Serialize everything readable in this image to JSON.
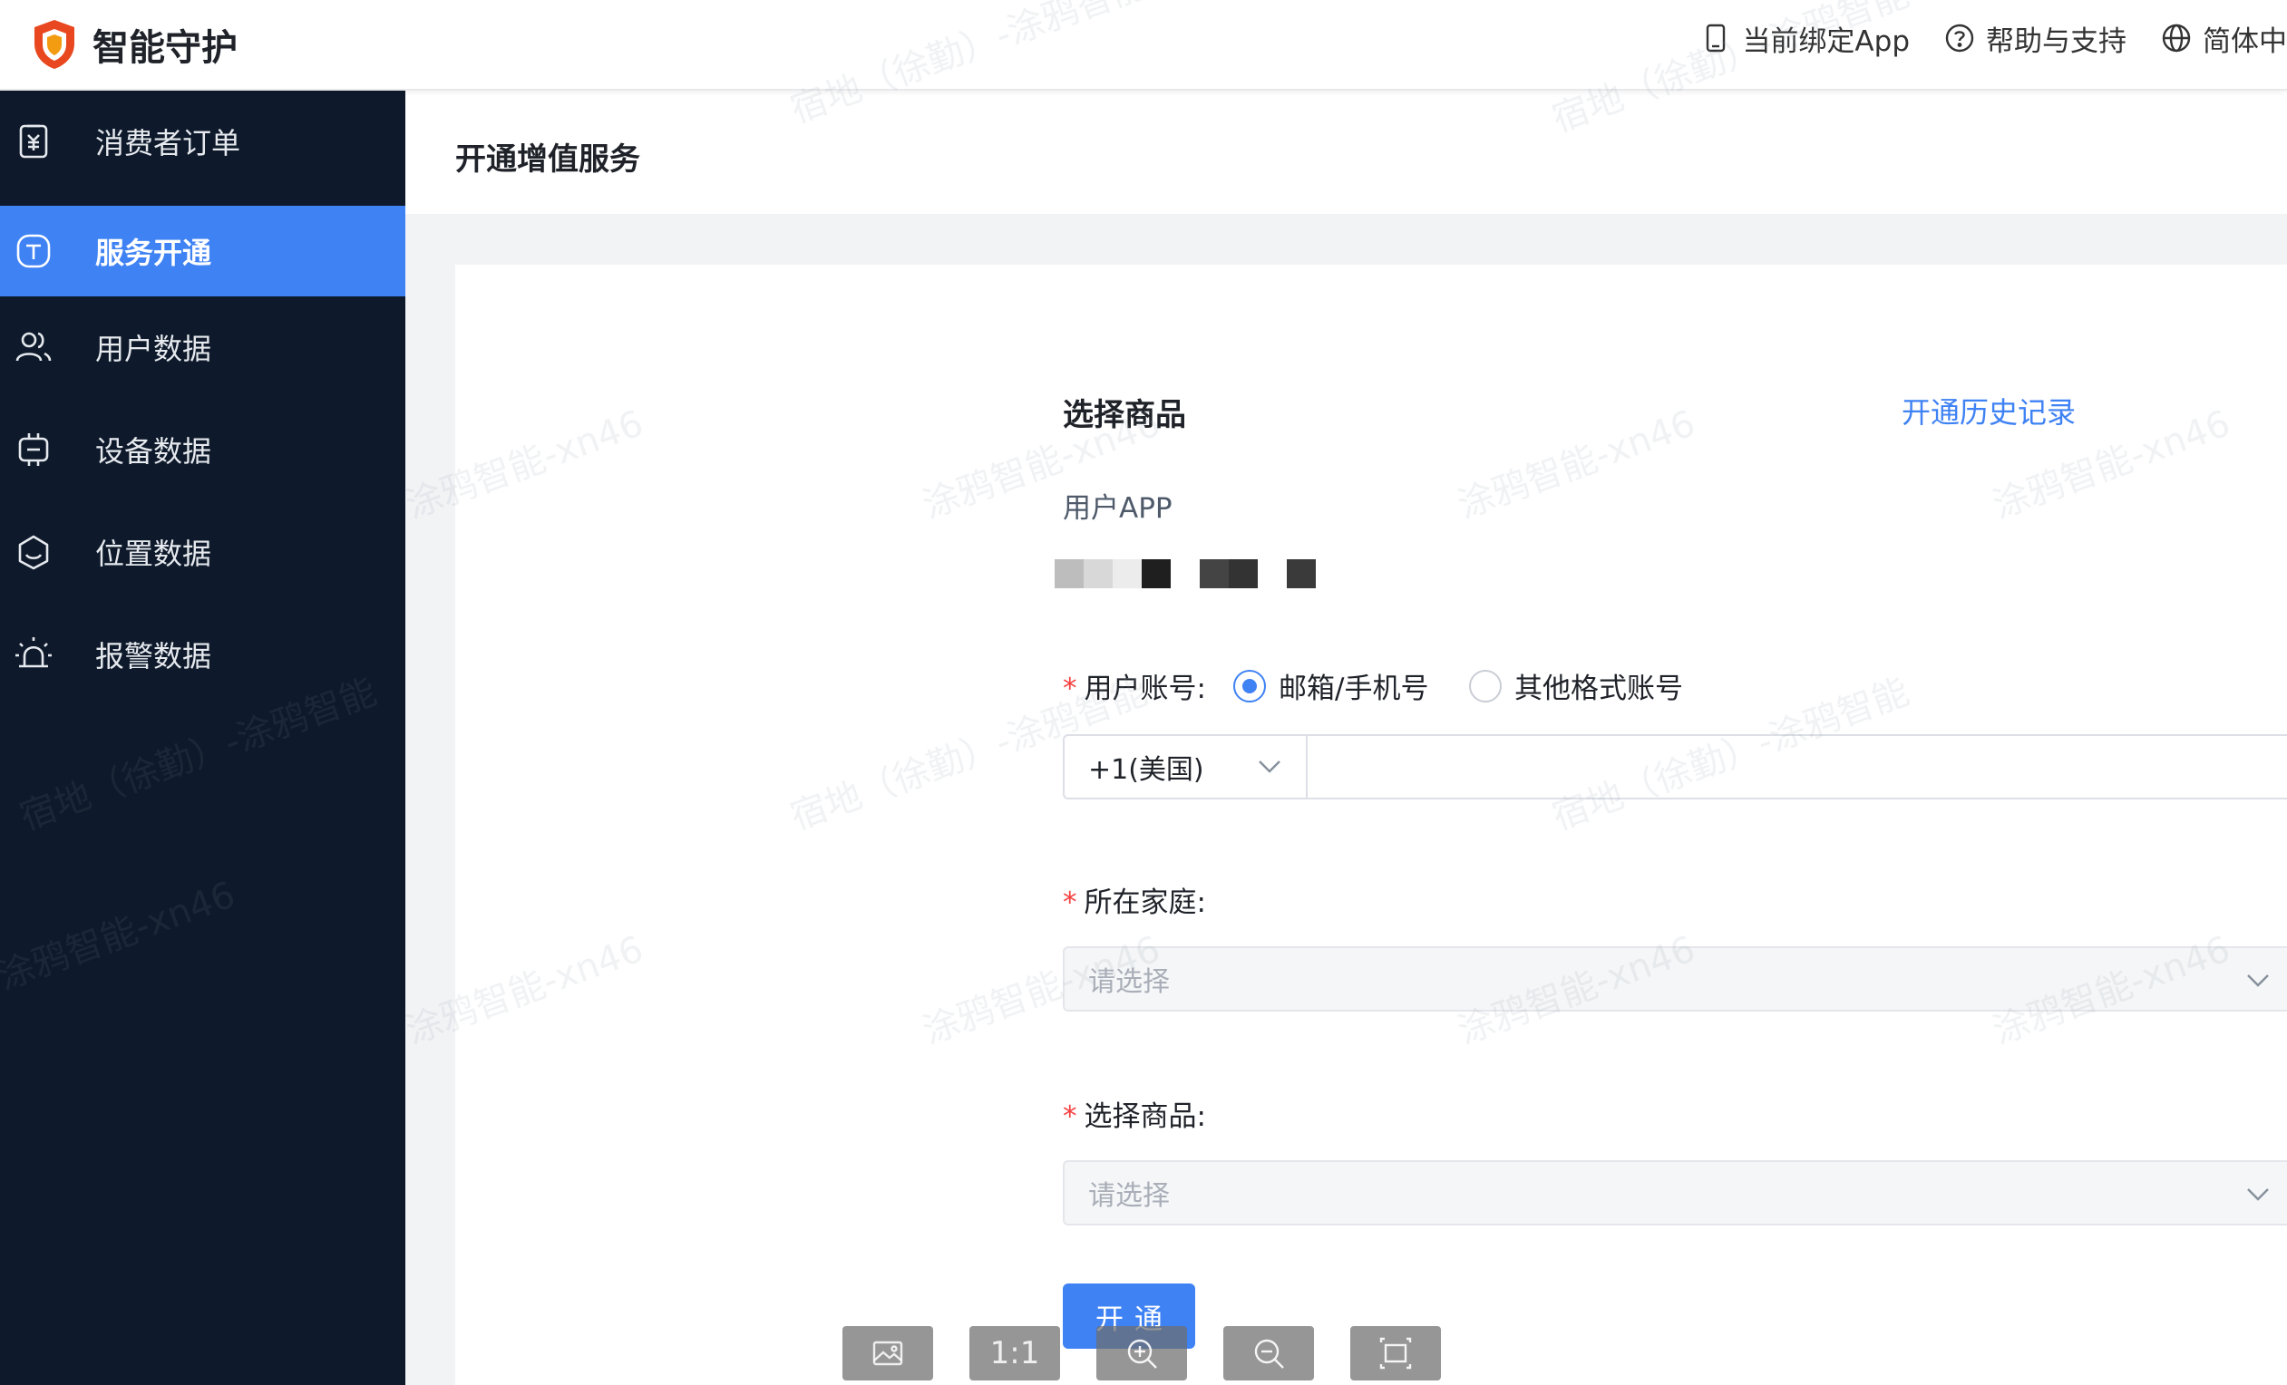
{
  "header": {
    "brand_title": "智能守护",
    "actions": [
      {
        "label": "当前绑定App",
        "icon": "tablet-icon"
      },
      {
        "label": "帮助与支持",
        "icon": "help-circle-icon"
      },
      {
        "label": "简体中",
        "icon": "globe-icon"
      }
    ]
  },
  "sidebar": {
    "items": [
      {
        "label": "消费者订单",
        "icon": "order-icon",
        "active": false
      },
      {
        "label": "服务开通",
        "icon": "service-box-icon",
        "active": true
      },
      {
        "label": "用户数据",
        "icon": "users-icon",
        "active": false
      },
      {
        "label": "设备数据",
        "icon": "device-icon",
        "active": false
      },
      {
        "label": "位置数据",
        "icon": "location-icon",
        "active": false
      },
      {
        "label": "报警数据",
        "icon": "alarm-icon",
        "active": false
      }
    ]
  },
  "page": {
    "title": "开通增值服务"
  },
  "form": {
    "section_title": "选择商品",
    "history_link": "开通历史记录",
    "app_label": "用户APP",
    "account_label": "用户账号:",
    "account_options": [
      {
        "label": "邮箱/手机号",
        "checked": true
      },
      {
        "label": "其他格式账号",
        "checked": false
      }
    ],
    "country_code": "+1(美国)",
    "phone_value": "",
    "family_label": "所在家庭:",
    "family_placeholder": "请选择",
    "product_label": "选择商品:",
    "product_placeholder": "请选择",
    "submit_label": "开通"
  },
  "viewer_toolbar": {
    "actual_size_label": "1:1"
  },
  "watermarks": [
    "涂鸦智能-xn46",
    "宿地（徐勤）-涂鸦智能"
  ],
  "colors": {
    "sidebar_bg": "#0e1a2b",
    "accent": "#3f82f4",
    "required": "#f53f3f"
  }
}
